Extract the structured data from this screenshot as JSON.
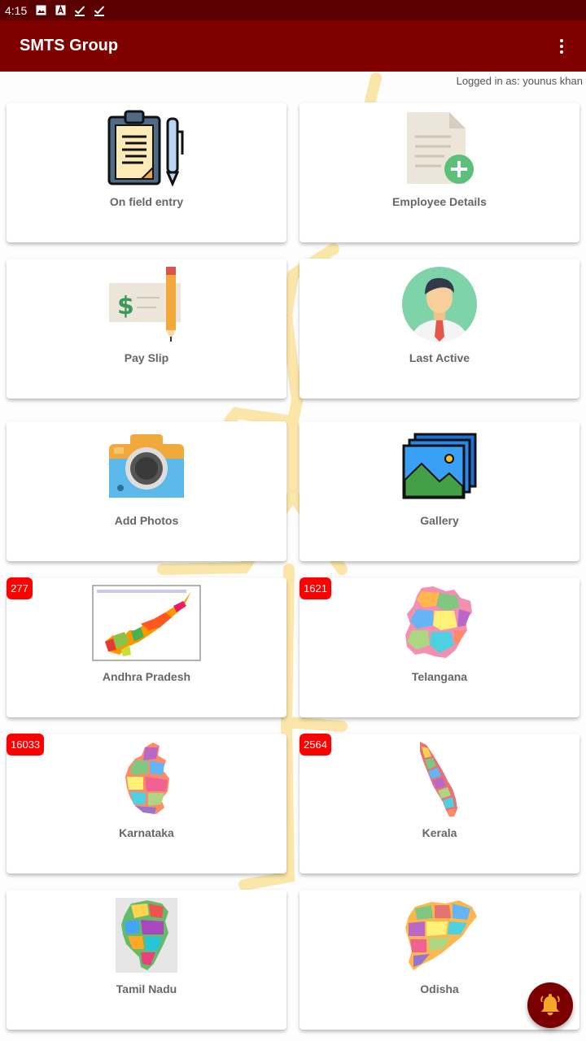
{
  "status_bar": {
    "time": "4:15",
    "icons": [
      "image-icon",
      "font-icon",
      "check-icon",
      "check-icon"
    ]
  },
  "app_bar": {
    "title": "SMTS Group",
    "menu_icon": "more-vert-icon"
  },
  "logged_in_label": "Logged in as: younus khan",
  "tiles": [
    {
      "label": "On field entry",
      "icon": "clipboard-pen-icon"
    },
    {
      "label": "Employee Details",
      "icon": "document-add-icon"
    },
    {
      "label": "Pay Slip",
      "icon": "cheque-pencil-icon"
    },
    {
      "label": "Last Active",
      "icon": "user-avatar-icon"
    },
    {
      "label": "Add Photos",
      "icon": "camera-icon"
    },
    {
      "label": "Gallery",
      "icon": "gallery-icon"
    },
    {
      "label": "Andhra Pradesh",
      "badge": "277",
      "icon": "andhra-pradesh-map-icon"
    },
    {
      "label": "Telangana",
      "badge": "1621",
      "icon": "telangana-map-icon"
    },
    {
      "label": "Karnataka",
      "badge": "16033",
      "icon": "karnataka-map-icon"
    },
    {
      "label": "Kerala",
      "badge": "2564",
      "icon": "kerala-map-icon"
    },
    {
      "label": "Tamil Nadu",
      "icon": "tamil-nadu-map-icon"
    },
    {
      "label": "Odisha",
      "icon": "odisha-map-icon"
    }
  ],
  "fab": {
    "icon": "bell-icon"
  },
  "colors": {
    "status_bar": "#5b0000",
    "app_bar": "#800000",
    "badge": "#ff0000",
    "fab": "#7a0000"
  }
}
